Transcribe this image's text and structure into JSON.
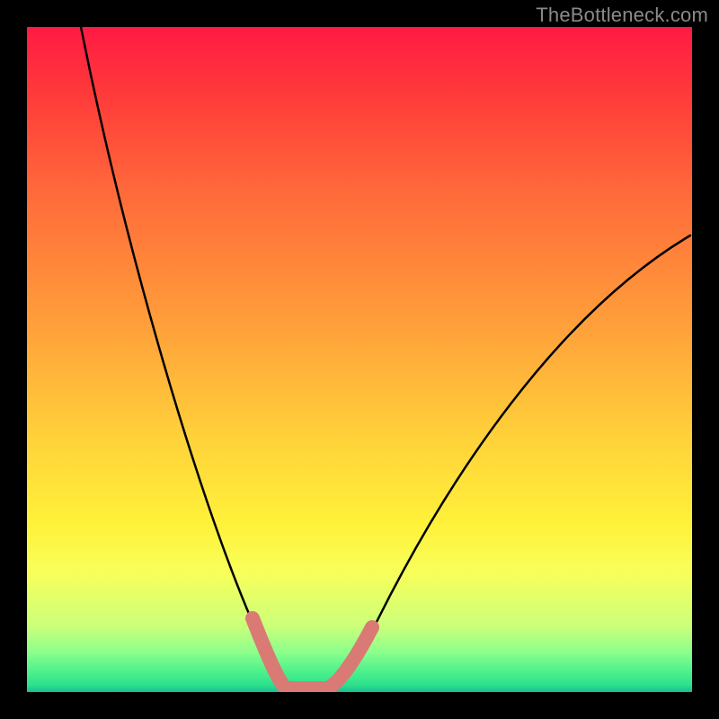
{
  "watermark": "TheBottleneck.com",
  "chart_data": {
    "type": "line",
    "title": "",
    "xlabel": "",
    "ylabel": "",
    "xlim": [
      0,
      100
    ],
    "ylim": [
      0,
      100
    ],
    "grid": false,
    "legend": false,
    "background_gradient": {
      "direction": "vertical",
      "stops": [
        {
          "pos": 0,
          "color": "#ff1a44"
        },
        {
          "pos": 25,
          "color": "#ff6a3a"
        },
        {
          "pos": 62,
          "color": "#ffd23a"
        },
        {
          "pos": 82,
          "color": "#f8ff5a"
        },
        {
          "pos": 94,
          "color": "#8cff8c"
        },
        {
          "pos": 100,
          "color": "#17bd93"
        }
      ]
    },
    "series": [
      {
        "name": "bottleneck-curve",
        "color": "#000000",
        "x": [
          8,
          12,
          18,
          24,
          30,
          34,
          37,
          39,
          42,
          45,
          48,
          53,
          60,
          70,
          82,
          95,
          100
        ],
        "y": [
          100,
          80,
          58,
          38,
          20,
          10,
          4,
          1,
          0,
          1,
          5,
          14,
          28,
          46,
          60,
          68,
          69
        ]
      },
      {
        "name": "optimal-range-highlight",
        "color": "#d97a74",
        "x": [
          34,
          36,
          38,
          40,
          42,
          44,
          46,
          48,
          51,
          52
        ],
        "y": [
          11,
          6,
          2,
          0,
          0,
          0,
          2,
          5,
          10,
          12
        ]
      }
    ],
    "notes": "Axes are unlabeled in the source image; x/y values are estimated on a 0–100 normalized scale. y=0 is the bottom (green) edge, y=100 is the top (red) edge."
  }
}
